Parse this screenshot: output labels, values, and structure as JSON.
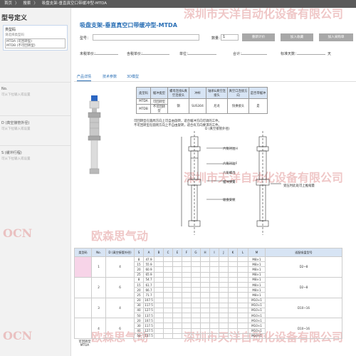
{
  "breadcrumb": [
    "首页",
    "搜索",
    "吸盘支架-垂直真空口带缓冲型-MTDA"
  ],
  "sidebar": {
    "title": "型号定义",
    "type_block": {
      "title": "类型码",
      "subtitle": "请选择类型码",
      "options": [
        "MTDA (可回转型)",
        "MTDB (不可回转型)"
      ]
    },
    "items": [
      {
        "label": "No.",
        "hint": "可从下拉输入或设置"
      },
      {
        "label": "D (真空接管外径)",
        "hint": "可从下拉输入或设置"
      },
      {
        "label": "S (缓冲行程)",
        "hint": "可从下拉输入或设置"
      }
    ]
  },
  "watermarks": [
    "OCN",
    "欧森思气动",
    "深圳市天洋自动化设备有限公司"
  ],
  "product": {
    "title": "吸盘支架-垂直真空口带缓冲型-MTDA",
    "model_label": "型号：",
    "qty_label": "数量：",
    "qty_value": "1",
    "buttons": [
      "重新计价",
      "加入收藏",
      "加入采购单"
    ]
  },
  "price_row": {
    "labels": [
      "未税单价：",
      "含税单价：",
      "单位：",
      "合计：",
      "标准天数：",
      "天"
    ]
  },
  "tabs": [
    "产品详情",
    "技术参数",
    "3D模型"
  ],
  "spec_table": {
    "header": [
      "类型码",
      "缓冲类型",
      "螺母连接&真空连接头",
      "冲杆",
      "轴承&真空连接头",
      "真空口连接方向",
      "是否带缓冲"
    ],
    "rows": [
      [
        "MTDA",
        "可回转型",
        "钢",
        "SUS304",
        "尼龙",
        "快换接头",
        "是"
      ],
      [
        "MTDB",
        "不可回转型",
        "",
        "",
        "",
        "",
        ""
      ]
    ]
  },
  "notes": [
    "可回转型在圆周方向上可自由旋转，适合缓冲方向可调的工件。",
    "不可回转型在圆周方向上不自由旋转，适合有方向要求的工件。",
    "D (真空接管外径)"
  ],
  "drawing_labels": [
    "六角对边H",
    "六角对边F",
    "六角螺母",
    "缓冲弹簧",
    "吸盘安装",
    "受压时此处可上推缩量"
  ],
  "dim_table": {
    "header": [
      "类型码",
      "No.",
      "D (真空接管外径)",
      "S",
      "A",
      "B",
      "C",
      "E",
      "F",
      "G",
      "H",
      "I",
      "J",
      "K",
      "L",
      "M",
      "适配吸盘型号"
    ],
    "groups": [
      {
        "type": "MTDA",
        "no": "1",
        "d": "4",
        "s": [
          "8",
          "15",
          "20",
          "25"
        ],
        "a": [
          "47.9",
          "55.9",
          "60.9",
          "65.9"
        ],
        "m": [
          "M8×1",
          "M8×1",
          "M8×1",
          "M8×1"
        ]
      },
      {
        "type": "MTDA",
        "no": "2",
        "d": "6",
        "s": [
          "8",
          "15",
          "20",
          "25"
        ],
        "a": [
          "54.7",
          "61.7",
          "66.7",
          "71.7"
        ],
        "m": [
          "M8×1",
          "M8×1",
          "M8×1",
          "M8×1"
        ]
      },
      {
        "type": "MTDA",
        "no": "3",
        "d": "4",
        "s": [
          "20",
          "30",
          "40",
          "50"
        ],
        "a": [
          "107.5",
          "117.5",
          "127.5",
          "137.5"
        ],
        "m": [
          "M10×1",
          "M10×1",
          "M10×1",
          "M10×1"
        ]
      },
      {
        "type": "MTDA",
        "no": "4",
        "d": "6",
        "s": [
          "20",
          "30",
          "40",
          "50"
        ],
        "a": [
          "107.5",
          "117.5",
          "127.5",
          "137.5"
        ],
        "m": [
          "M10×1",
          "M10×1",
          "M10×1",
          "M10×1"
        ]
      }
    ],
    "bottom_label": "可回转型 MTDA",
    "range_a": "D2~8",
    "range_b": "D6~8",
    "range_c": "D10~16"
  },
  "colors": {
    "accent": "#2a6fb5",
    "header_bg": "#d7e4f4",
    "topbar": "#5a5a5a",
    "watermark": "#e6a2a2"
  }
}
